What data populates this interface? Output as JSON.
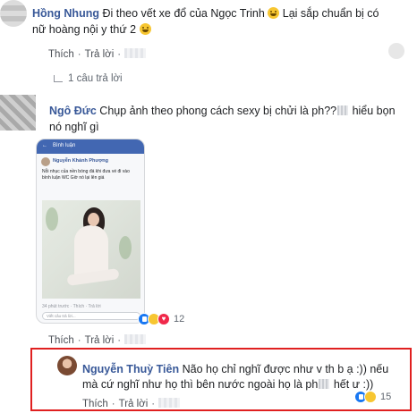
{
  "c1": {
    "author": "Hồng Nhung",
    "line1": " Đi theo vết xe đổ của Ngọc Trinh ",
    "line1b": " Lại sắp chuẩn bị có",
    "line2": "nữ hoàng nội y thứ 2 ",
    "like": "Thích",
    "reply": "Trả lời",
    "replies": "1 câu trả lời"
  },
  "c2": {
    "author": "Ngô Đức",
    "line1a": " Chụp ảnh theo phong cách sexy bị chửi là ph",
    "line1b": "??",
    "line1c": " hiểu bọn",
    "line2": "nó nghĩ gì",
    "like": "Thích",
    "reply": "Trả lời",
    "reactions": "12"
  },
  "screenshot": {
    "bar_label": "Bình luận",
    "user": "Nguyễn Khánh Phượng",
    "text": "Nỗi nhục của nền bóng đá khi đưa vé đi vào bình luận WC Giờ nó lại lên giá",
    "meta": "34 phút trước · Thích · Trả lời",
    "input_placeholder": "Viết câu trả lời..."
  },
  "c3": {
    "author": "Nguyễn Thuỳ Tiên",
    "line1": " Não họ chỉ nghĩ được như v th b ạ :)) nếu",
    "line2a": "mà cứ nghĩ như họ thì bên nước ngoài họ là ph",
    "line2b": " hết ư :))",
    "like": "Thích",
    "reply": "Trả lời",
    "reactions": "15"
  },
  "colors": {
    "author": "#385898",
    "highlight": "#e02020",
    "like": "#1877f2"
  }
}
